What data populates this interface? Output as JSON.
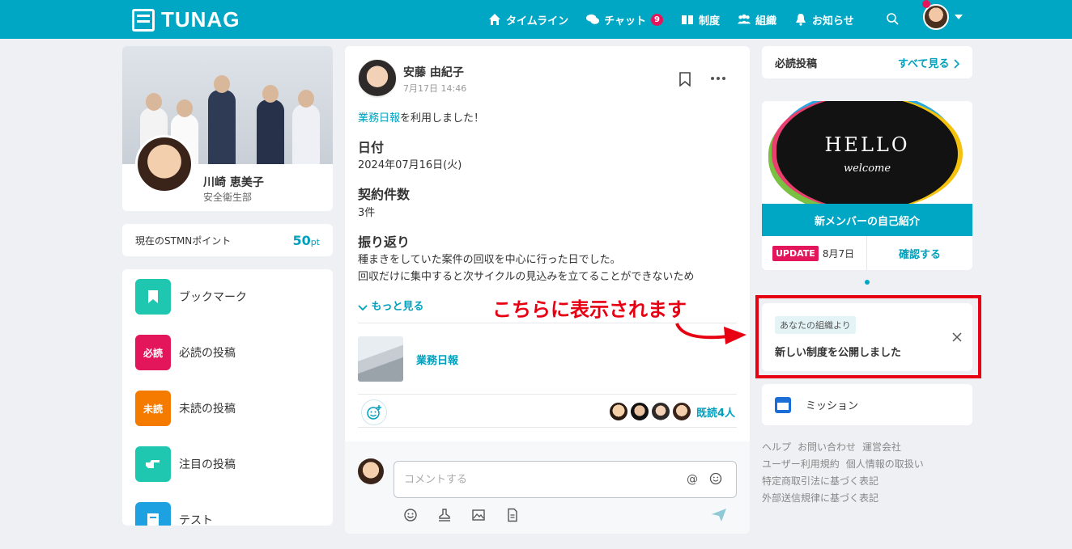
{
  "header": {
    "logo_text": "TUNAG",
    "nav": [
      {
        "label": "タイムライン",
        "icon": "home-icon"
      },
      {
        "label": "チャット",
        "icon": "chat-icon",
        "badge": "9"
      },
      {
        "label": "制度",
        "icon": "book-icon"
      },
      {
        "label": "組織",
        "icon": "people-icon"
      },
      {
        "label": "お知らせ",
        "icon": "bell-icon"
      }
    ]
  },
  "profile": {
    "name": "川崎 恵美子",
    "department": "安全衛生部"
  },
  "points": {
    "label": "現在のSTMNポイント",
    "value": "50",
    "unit": "pt"
  },
  "menu": [
    {
      "label": "ブックマーク",
      "icon": "bookmark-icon",
      "color": "#1fc7b0",
      "text": ""
    },
    {
      "label": "必読の投稿",
      "icon": "must-read-icon",
      "color": "#e4165b",
      "text": "必読"
    },
    {
      "label": "未読の投稿",
      "icon": "unread-icon",
      "color": "#f47b00",
      "text": "未読"
    },
    {
      "label": "注目の投稿",
      "icon": "pointing-hand-icon",
      "color": "#1fc7b0",
      "text": ""
    },
    {
      "label": "テスト",
      "icon": "test-icon",
      "color": "#1ea1e0",
      "text": ""
    }
  ],
  "post": {
    "author": "安藤 由紀子",
    "date": "7月17日 14:46",
    "intro_link": "業務日報",
    "intro_rest": "を利用しました！",
    "sections": [
      {
        "title": "日付",
        "body": "2024年07月16日(火)"
      },
      {
        "title": "契約件数",
        "body": "3件"
      },
      {
        "title": "振り返り",
        "body": "種まきをしていた案件の回収を中心に行った日でした。"
      }
    ],
    "cut_line": "回収だけに集中すると次サイクルの見込みを立てることができないため",
    "show_more": "もっと見る",
    "attachment_label": "業務日報",
    "read_count": "既読4人"
  },
  "comment": {
    "placeholder": "コメントする",
    "at_symbol": "@"
  },
  "right": {
    "must_read_title": "必読投稿",
    "see_all": "すべて見る",
    "feature_image_text": "HELLO",
    "feature_image_sub": "welcome",
    "feature_title": "新メンバーの自己紹介",
    "update_badge": "UPDATE",
    "update_date": "8月7日",
    "confirm": "確認する",
    "notice_tag": "あなたの組織より",
    "notice_text": "新しい制度を公開しました",
    "mission_label": "ミッション",
    "footer_links": [
      "ヘルプ",
      "お問い合わせ",
      "運営会社",
      "ユーザー利用規約",
      "個人情報の取扱い",
      "特定商取引法に基づく表記",
      "外部送信規律に基づく表記"
    ]
  },
  "annotation": {
    "text": "こちらに表示されます",
    "color": "#e60012"
  },
  "colors": {
    "brand": "#00a7c4",
    "link": "#00a0bd",
    "alert": "#e4165b"
  }
}
